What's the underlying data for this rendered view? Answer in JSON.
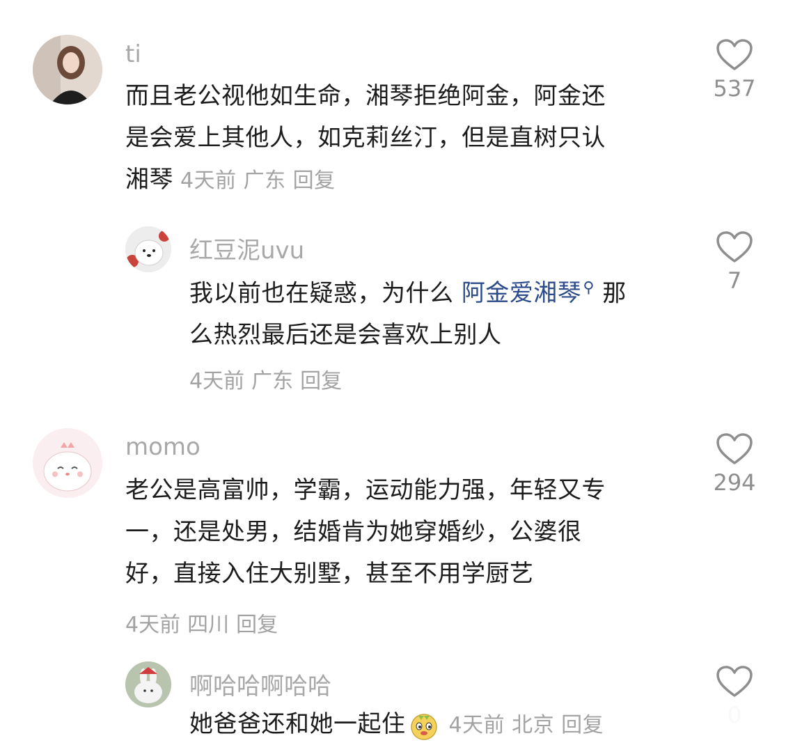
{
  "comments": [
    {
      "username": "ti",
      "text": "而且老公视他如生命，湘琴拒绝阿金，阿金还是会爱上其他人，如克莉丝汀，但是直树只认湘琴",
      "lines": [
        "而且老公视他如生命，湘琴拒绝阿金，阿金还",
        "是会爱上其他人，如克莉丝汀，但是直树只认",
        "湘琴"
      ],
      "time": "4天前",
      "location": "广东",
      "reply_label": "回复",
      "likes": "537"
    },
    {
      "username": "红豆泥uvu",
      "text_before": "我以前也在疑惑，为什么",
      "search_term": "阿金爱湘琴",
      "text_after": "那",
      "line2": "么热烈最后还是会喜欢上别人",
      "time": "4天前",
      "location": "广东",
      "reply_label": "回复",
      "likes": "7"
    },
    {
      "username": "momo",
      "lines": [
        "老公是高富帅，学霸，运动能力强，年轻又专",
        "一，还是处男，结婚肯为她穿婚纱，公婆很",
        "好，直接入住大别墅，甚至不用学厨艺"
      ],
      "time": "4天前",
      "location": "四川",
      "reply_label": "回复",
      "likes": "294"
    },
    {
      "username": "啊哈哈啊哈哈",
      "text": "她爸爸还和她一起住",
      "emoji": "doge-face-icon",
      "time": "4天前",
      "location": "北京",
      "reply_label": "回复",
      "likes": "0"
    }
  ],
  "colors": {
    "username": "#a8a8a8",
    "meta": "#a3a3a3",
    "search_link": "#2c4b8a",
    "like_outline": "#8e8e8e"
  }
}
